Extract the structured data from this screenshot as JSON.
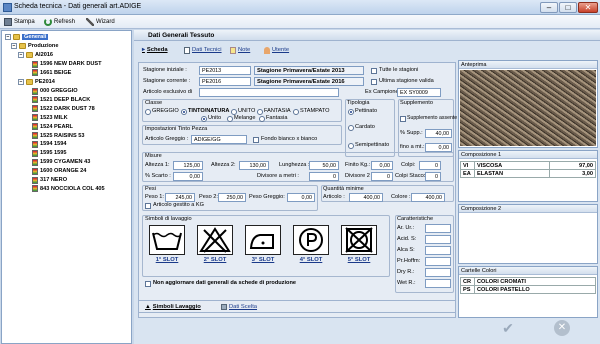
{
  "window": {
    "title": "Scheda tecnica - Dati generali art.ADIGE"
  },
  "toolbar": {
    "stampa": "Stampa",
    "refresh": "Refresh",
    "wizard": "Wizard"
  },
  "tree": {
    "root": "Generali",
    "production": "Produzione",
    "group1": "AI2016",
    "group1_items": [
      "1596 NEW DARK DUST",
      "1661 BEIGE"
    ],
    "group2": "PE2014",
    "group2_items": [
      "000 GREGGIO",
      "1521 DEEP BLACK",
      "1522 DARK DUST 78",
      "1523 MILK",
      "1524 PEARL",
      "1525 RAISINS 53",
      "1594 1594",
      "1595 1595",
      "1599 CYGAMEN 43",
      "1600 ORANGE 24",
      "317 NERO",
      "843 NOCCIOLA COL 405"
    ]
  },
  "main": {
    "header": "Dati Generali Tessuto",
    "tabs": [
      "Scheda",
      "Dati Tecnici",
      "Note",
      "Utente"
    ],
    "stagione_iniziale_label": "Stagione iniziale :",
    "stagione_iniziale": "PE2013",
    "stagione_iniziale_desc": "Stagione Primavera/Estate 2013",
    "stagione_corrente_label": "Stagione corrente :",
    "stagione_corrente": "PE2016",
    "stagione_corrente_desc": "Stagione Primavera/Estate 2016",
    "tutte_stagioni": "Tutte le stagioni",
    "ultima_stagione": "Ultima stagione valida",
    "articolo_esclusivo_label": "Articolo esclusivo di",
    "ex_campione_label": "Ex Campione :",
    "ex_campione": "EX SY0009",
    "classe_label": "Classe",
    "classe_options": [
      "GREGGIO",
      "TINTO/NATURA",
      "UNITO",
      "FANTASIA",
      "STAMPATO"
    ],
    "sub_options": [
      "Unito",
      "Melange",
      "Fantasia"
    ],
    "tipologia_label": "Tipologia",
    "tipologia_options": [
      "Pettinato",
      "Cardato",
      "Semipettinato"
    ],
    "supplemento_label": "Supplemento",
    "supplemento_assente": "Supplemento assente",
    "supp_pct_label": "% Supp.:",
    "supp_pct": "40,00",
    "fino_a_label": "fino a mt.:",
    "fino_a": "0,00",
    "tinto_pezza_label": "Impostazioni Tinto Pezza",
    "articolo_greggio_label": "Articolo Greggio :",
    "articolo_greggio": "ADIGE/GG",
    "fondo_bianco": "Fondo bianco x bianco",
    "misure_label": "Misure",
    "altezza1_label": "Altezza 1:",
    "altezza1": "125,00",
    "altezza2_label": "Altezza 2:",
    "altezza2": "130,00",
    "lunghezza_label": "Lunghezza :",
    "lunghezza": "50,00",
    "finito_kg_label": "Finito Kg.:",
    "finito_kg": "0,00",
    "colpi_label": "Colpi:",
    "colpi": "0",
    "scarto_label": "% Scarto :",
    "scarto": "0,00",
    "divisore_metri_label": "Divisore a metri :",
    "divisore_metri": "0",
    "divisore2_label": "Divisore 2 :",
    "divisore2": "0",
    "colpi_stacco_label": "Colpi Stacco:",
    "colpi_stacco": "0",
    "pesi_label": "Pesi",
    "peso1_label": "Peso 1:",
    "peso1": "245,00",
    "peso2_label": "Peso 2:",
    "peso2": "250,00",
    "peso_greggio_label": "Peso Greggio:",
    "peso_greggio": "0,00",
    "articolo_gestito": "Articolo gestito a KG",
    "quantita_label": "Quantità minime",
    "q_articolo_label": "Articolo :",
    "q_articolo": "400,00",
    "q_colore_label": "Colore :",
    "q_colore": "400,00",
    "simboli_label": "Simboli di lavaggio",
    "slots": [
      "1° SLOT",
      "2° SLOT",
      "3° SLOT",
      "4° SLOT",
      "5° SLOT"
    ],
    "caratteristiche_label": "Caratteristiche",
    "caratteristiche": [
      "Ar. Ur.:",
      "Acid. S:",
      "Alca S:",
      "Pr.Hoffm:",
      "Dry R.:",
      "Wet R.:"
    ],
    "non_aggiornare": "Non aggiornare dati generali da schede di produzione",
    "bottom_tabs": [
      "Simboli Lavaggio",
      "Dati Scelta"
    ]
  },
  "right": {
    "anteprima": "Anteprima",
    "composizione1": "Composizione 1",
    "comp1_rows": [
      [
        "VI",
        "VISCOSA",
        "97,00"
      ],
      [
        "EA",
        "ELASTAN",
        "3,00"
      ]
    ],
    "composizione2": "Composizione 2",
    "cartelle": "Cartelle Colori",
    "cartelle_rows": [
      [
        "CR",
        "COLORI CROMATI"
      ],
      [
        "PS",
        "COLORI PASTELLO"
      ]
    ]
  }
}
